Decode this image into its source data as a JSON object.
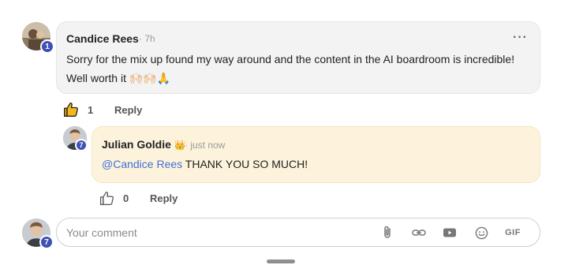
{
  "comment": {
    "author": "Candice Rees",
    "time": "· 7h",
    "level": "1",
    "text_line1": "Sorry for the mix up found my way around and the content in the AI boardroom is incredible!",
    "text_line2": "Well worth it ",
    "emoji": "🙌🏻🙌🏻🙏",
    "like_count": "1",
    "reply_label": "Reply",
    "more_label": "···"
  },
  "reply": {
    "author": "Julian Goldie",
    "crown": "👑",
    "time": "· just now",
    "level": "7",
    "mention": "@Candice Rees",
    "text": " THANK YOU SO MUCH!",
    "like_count": "0",
    "reply_label": "Reply"
  },
  "composer": {
    "level": "7",
    "placeholder": "Your comment",
    "gif_label": "GIF",
    "tools": [
      "paperclip-icon",
      "link-icon",
      "video-icon",
      "emoji-icon",
      "gif-icon"
    ]
  },
  "colors": {
    "badge": "#3f51b5",
    "mention": "#3f6fd8",
    "reply_bubble": "#fdf3dc",
    "main_bubble": "#f3f3f3",
    "like_active": "#e8a317"
  }
}
